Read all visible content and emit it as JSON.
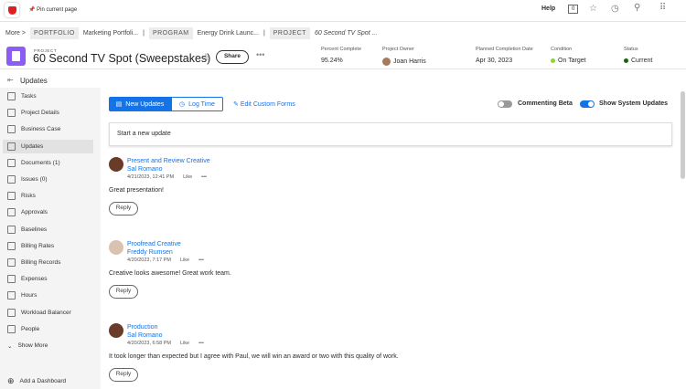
{
  "topbar": {
    "pin": "Pin current page",
    "help": "Help",
    "count": "0"
  },
  "breadcrumb": {
    "more": "More >",
    "portfolio_tag": "PORTFOLIO",
    "portfolio": "Marketing Portfoli...",
    "program_tag": "PROGRAM",
    "program": "Energy Drink Launc...",
    "project_tag": "PROJECT",
    "project": "60 Second TV Spot ..."
  },
  "header": {
    "label": "PROJECT",
    "title": "60 Second TV Spot (Sweepstakes)",
    "share": "Share",
    "meta": [
      {
        "k": "Percent Complete",
        "v": "95.24%"
      },
      {
        "k": "Project Owner",
        "v": "Joan Harris"
      },
      {
        "k": "Planned Completion Date",
        "v": "Apr 30, 2023"
      },
      {
        "k": "Condition",
        "v": "On Target"
      },
      {
        "k": "Status",
        "v": "Current"
      }
    ],
    "colors": {
      "on_target": "#8fd13b",
      "current": "#12670e"
    }
  },
  "section": "Updates",
  "sidebar": {
    "items": [
      "Tasks",
      "Project Details",
      "Business Case",
      "Updates",
      "Documents (1)",
      "Issues (0)",
      "Risks",
      "Approvals",
      "Baselines",
      "Billing Rates",
      "Billing Records",
      "Expenses",
      "Hours",
      "Workload Balancer",
      "People"
    ],
    "show_more": "Show More",
    "add_dashboard": "Add a Dashboard"
  },
  "toolbar": {
    "new_updates": "New Updates",
    "log_time": "Log Time",
    "edit_forms": "Edit Custom Forms",
    "commenting_beta": "Commenting Beta",
    "show_system": "Show System Updates"
  },
  "new_update_placeholder": "Start a new update",
  "posts": [
    {
      "title": "Present and Review Creative",
      "author": "Sal Romano",
      "time": "4/21/2023, 12:41 PM",
      "like": "Like",
      "body": "Great presentation!",
      "reply": "Reply"
    },
    {
      "title": "Proofread Creative",
      "author": "Freddy Rumsen",
      "time": "4/20/2023, 7:17 PM",
      "like": "Like",
      "body": "Creative looks awesome! Great work team.",
      "reply": "Reply"
    },
    {
      "title": "Production",
      "author": "Sal Romano",
      "time": "4/20/2023, 6:58 PM",
      "like": "Like",
      "body": "It took longer than expected but I agree with Paul, we will win an award or two with this quality of work.",
      "reply": "Reply"
    }
  ]
}
